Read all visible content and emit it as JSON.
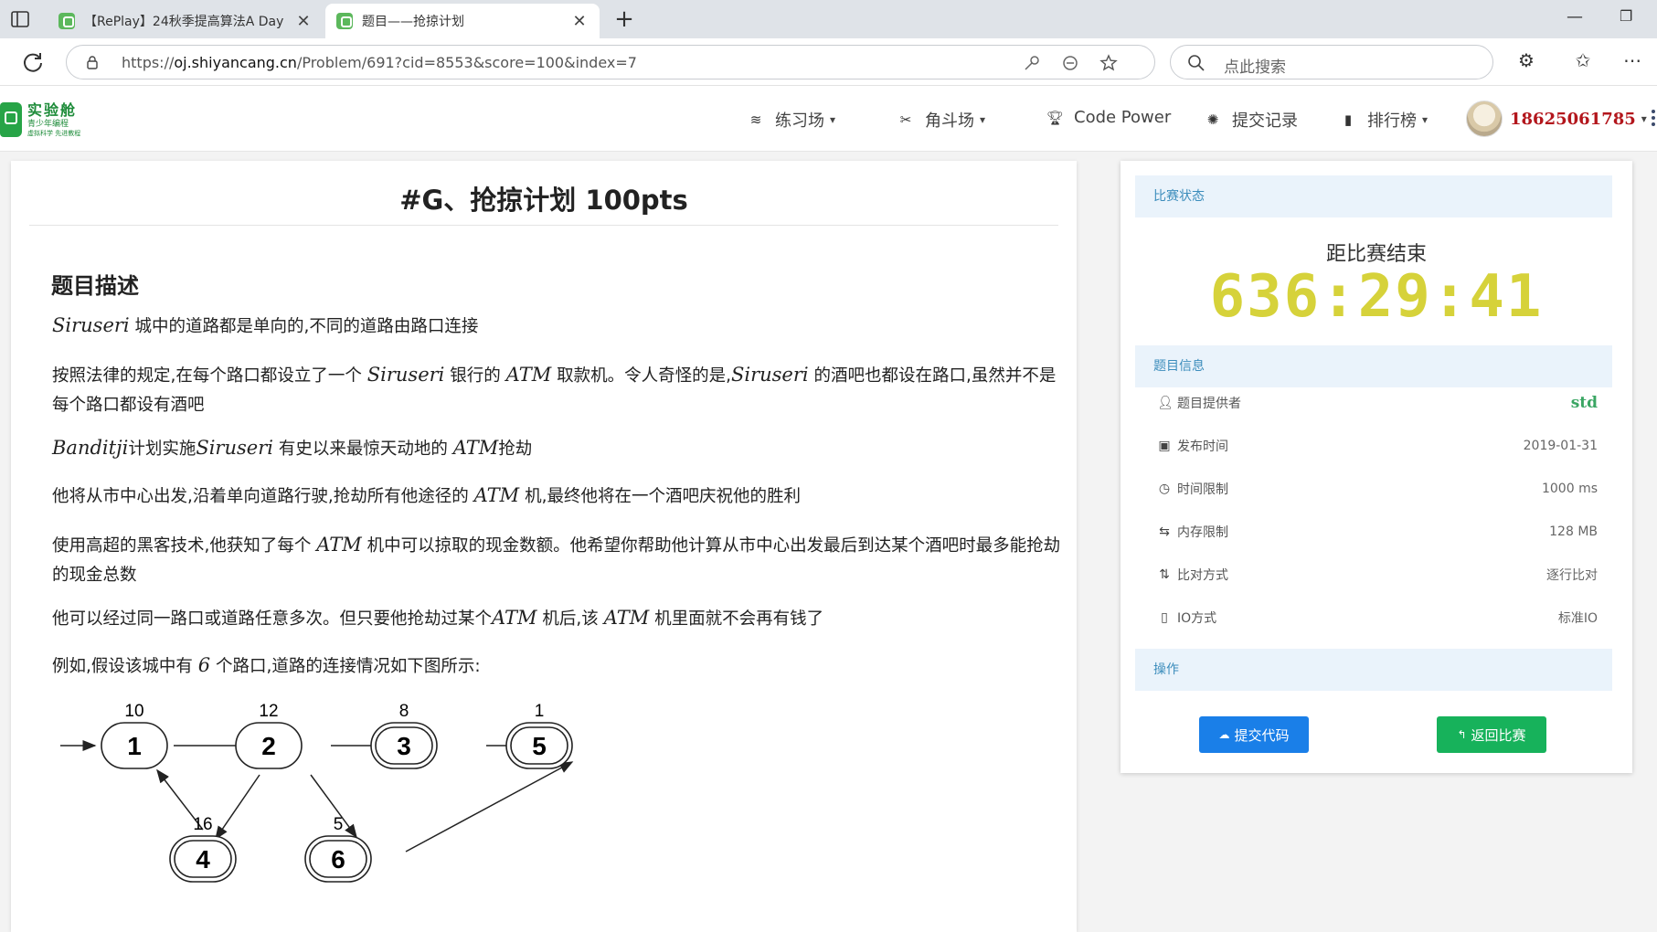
{
  "browser": {
    "tabs": [
      {
        "title": "【RePlay】24秋季提高算法A Day",
        "active": false
      },
      {
        "title": "题目——抢掠计划",
        "active": true
      }
    ],
    "url_prefix": "https://",
    "url_host": "oj.shiyancang.cn",
    "url_path": "/Problem/691?cid=8553&score=100&index=7",
    "search_placeholder": "点此搜索"
  },
  "site": {
    "logo_cn": "实验舱",
    "logo_sub": "青少年编程",
    "logo_sub2": "虚拟科学 先进教程",
    "nav": [
      {
        "label": "练习场",
        "icon": "layers-icon",
        "dropdown": true
      },
      {
        "label": "角斗场",
        "icon": "tools-icon",
        "dropdown": true
      },
      {
        "label": "Code Power",
        "icon": "trophy-icon",
        "dropdown": false
      },
      {
        "label": "提交记录",
        "icon": "bug-icon",
        "dropdown": false
      },
      {
        "label": "排行榜",
        "icon": "bar-chart-icon",
        "dropdown": true
      }
    ],
    "username": "18625061785"
  },
  "problem": {
    "title": "#G、抢掠计划 100pts",
    "section_heading": "题目描述",
    "p1": {
      "m1": "Siruseri",
      "t1": " 城中的道路都是单向的,不同的道路由路口连接"
    },
    "p2": {
      "t1": "按照法律的规定,在每个路口都设立了一个 ",
      "m1": "Siruseri",
      "t2": " 银行的 ",
      "m2": "ATM",
      "t3": " 取款机。令人奇怪的是,",
      "m3": "Siruseri",
      "t4": " 的酒吧也都设在路口,虽然并不是每个路口都设有酒吧"
    },
    "p3": {
      "m1": "Banditji",
      "t1": "计划实施",
      "m2": "Siruseri",
      "t2": " 有史以来最惊天动地的 ",
      "m3": "ATM",
      "t3": "抢劫"
    },
    "p4": {
      "t1": "他将从市中心出发,沿着单向道路行驶,抢劫所有他途径的 ",
      "m1": "ATM",
      "t2": " 机,最终他将在一个酒吧庆祝他的胜利"
    },
    "p5": {
      "t1": "使用高超的黑客技术,他获知了每个 ",
      "m1": "ATM",
      "t2": " 机中可以掠取的现金数额。他希望你帮助他计算从市中心出发最后到达某个酒吧时最多能抢劫的现金总数"
    },
    "p6": {
      "t1": "他可以经过同一路口或道路任意多次。但只要他抢劫过某个",
      "m1": "ATM",
      "t2": " 机后,该 ",
      "m2": "ATM",
      "t3": " 机里面就不会再有钱了"
    },
    "p7": {
      "t1": "例如,假设该城中有 ",
      "m1": "6",
      "t2": " 个路口,道路的连接情况如下图所示:"
    },
    "graph": {
      "nodes": [
        {
          "id": "1",
          "value": "10",
          "bar": false
        },
        {
          "id": "2",
          "value": "12",
          "bar": false
        },
        {
          "id": "3",
          "value": "8",
          "bar": true
        },
        {
          "id": "5",
          "value": "1",
          "bar": true
        },
        {
          "id": "4",
          "value": "16",
          "bar": true
        },
        {
          "id": "6",
          "value": "5",
          "bar": true
        }
      ]
    }
  },
  "sidebar": {
    "status_heading": "比赛状态",
    "countdown_label": "距比赛结束",
    "countdown": "636:29:41",
    "info_heading": "题目信息",
    "info": [
      {
        "label": "题目提供者",
        "value": "std",
        "icon": "user-icon"
      },
      {
        "label": "发布时间",
        "value": "2019-01-31",
        "icon": "calendar-icon"
      },
      {
        "label": "时间限制",
        "value": "1000 ms",
        "icon": "clock-icon"
      },
      {
        "label": "内存限制",
        "value": "128 MB",
        "icon": "sliders-icon"
      },
      {
        "label": "比对方式",
        "value": "逐行比对",
        "icon": "compare-icon"
      },
      {
        "label": "IO方式",
        "value": "标准IO",
        "icon": "file-icon"
      }
    ],
    "ops_heading": "操作",
    "submit_label": "提交代码",
    "back_label": "返回比赛",
    "colors": {
      "accent_blue": "#1a7fe8",
      "accent_green": "#17b25b",
      "countdown": "#d6d23a",
      "provider": "#3aa663"
    }
  }
}
